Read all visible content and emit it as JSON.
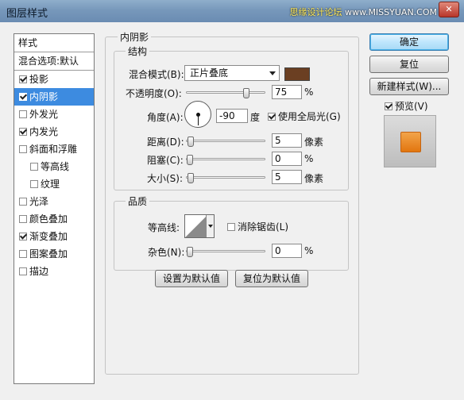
{
  "window": {
    "title": "图层样式",
    "watermark_site": "思缘设计论坛",
    "watermark_url": "www.MISSYUAN.COM",
    "close_glyph": "✕"
  },
  "style_list": {
    "header": "样式",
    "blend_options": "混合选项:默认",
    "items": [
      {
        "label": "投影",
        "checked": true
      },
      {
        "label": "内阴影",
        "checked": true,
        "selected": true
      },
      {
        "label": "外发光",
        "checked": false
      },
      {
        "label": "内发光",
        "checked": true
      },
      {
        "label": "斜面和浮雕",
        "checked": false
      },
      {
        "label": "等高线",
        "checked": false,
        "sub": true
      },
      {
        "label": "纹理",
        "checked": false,
        "sub": true
      },
      {
        "label": "光泽",
        "checked": false
      },
      {
        "label": "颜色叠加",
        "checked": false
      },
      {
        "label": "渐变叠加",
        "checked": true
      },
      {
        "label": "图案叠加",
        "checked": false
      },
      {
        "label": "描边",
        "checked": false
      }
    ]
  },
  "inner_shadow": {
    "title": "内阴影",
    "structure": {
      "title": "结构",
      "blend_mode_label": "混合模式(B):",
      "blend_mode_value": "正片叠底",
      "color": "#6b3f22",
      "opacity_label": "不透明度(O):",
      "opacity_value": "75",
      "opacity_unit": "%",
      "opacity_fraction": 0.75,
      "angle_label": "角度(A):",
      "angle_value": "-90",
      "angle_unit": "度",
      "global_light_label": "使用全局光(G)",
      "global_light_checked": true,
      "distance_label": "距离(D):",
      "distance_value": "5",
      "distance_unit": "像素",
      "choke_label": "阻塞(C):",
      "choke_value": "0",
      "choke_unit": "%",
      "size_label": "大小(S):",
      "size_value": "5",
      "size_unit": "像素"
    },
    "quality": {
      "title": "品质",
      "contour_label": "等高线:",
      "antialias_label": "消除锯齿(L)",
      "antialias_checked": false,
      "noise_label": "杂色(N):",
      "noise_value": "0",
      "noise_unit": "%"
    },
    "make_default": "设置为默认值",
    "reset_default": "复位为默认值"
  },
  "buttons": {
    "ok": "确定",
    "reset": "复位",
    "new_style": "新建样式(W)...",
    "preview_label": "预览(V)",
    "preview_checked": true
  }
}
